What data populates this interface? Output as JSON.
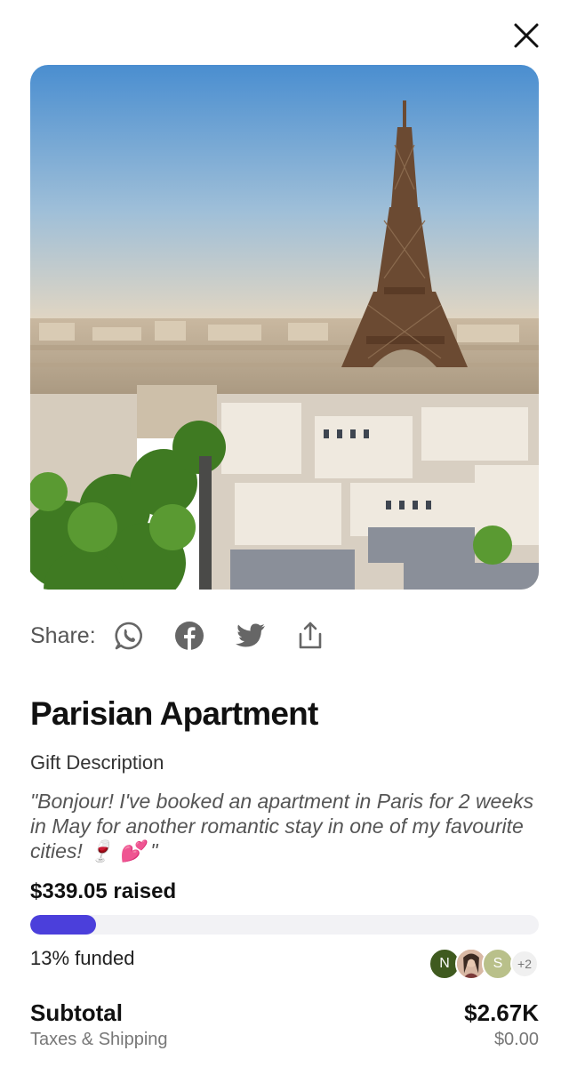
{
  "hero": {
    "image_alt": "Eiffel Tower over Paris rooftops"
  },
  "share": {
    "label": "Share:",
    "icons": [
      "whatsapp-icon",
      "facebook-icon",
      "twitter-icon",
      "share-upload-icon"
    ]
  },
  "gift": {
    "title": "Parisian Apartment",
    "description_label": "Gift Description",
    "description": "\"Bonjour! I've booked an apartment in Paris for 2 weeks in May for another romantic stay in one of my favourite cities! 🍷 💕 \""
  },
  "funding": {
    "raised_text": "$339.05 raised",
    "progress": 0.13,
    "funded_text": "13% funded",
    "contributors": [
      {
        "initial": "N",
        "color": "#3f5a1f"
      },
      {
        "initial": "",
        "color": "#c98a6c"
      },
      {
        "initial": "S",
        "color": "#b9c08a"
      }
    ],
    "more_count": "+2"
  },
  "totals": {
    "subtotal_label": "Subtotal",
    "subtotal_value": "$2.67K",
    "tax_label": "Taxes & Shipping",
    "tax_value": "$0.00"
  },
  "colors": {
    "accent": "#4b3fdb",
    "track": "#f2f2f5"
  }
}
